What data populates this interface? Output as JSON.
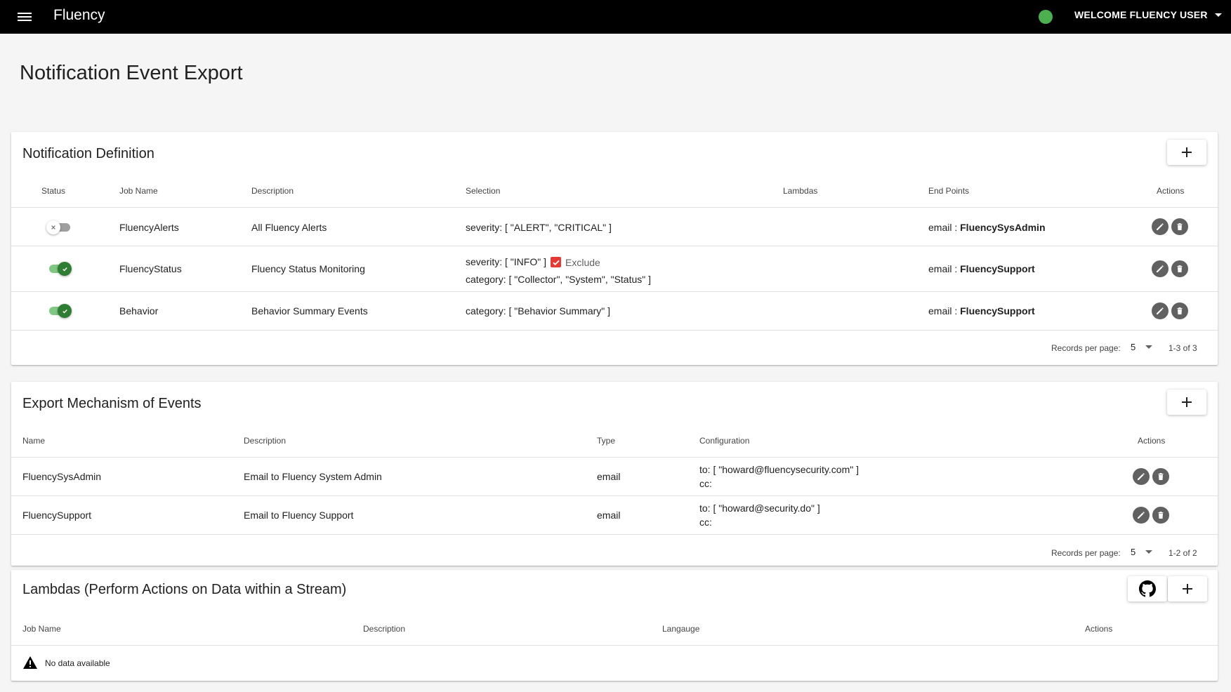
{
  "app": {
    "brand": "Fluency",
    "welcome": "WELCOME FLUENCY USER",
    "status_color": "#4caf50"
  },
  "page": {
    "title": "Notification Event Export"
  },
  "notification": {
    "title": "Notification Definition",
    "columns": [
      "Status",
      "Job Name",
      "Description",
      "Selection",
      "Lambdas",
      "End Points",
      "Actions"
    ],
    "rows": [
      {
        "enabled": false,
        "job_name": "FluencyAlerts",
        "description": "All Fluency Alerts",
        "selection_1": "severity: [ \"ALERT\", \"CRITICAL\" ]",
        "endpoint_prefix": "email : ",
        "endpoint_name": "FluencySysAdmin"
      },
      {
        "enabled": true,
        "job_name": "FluencyStatus",
        "description": "Fluency Status Monitoring",
        "selection_1": "severity: [ \"INFO\" ]",
        "exclude_label": "Exclude",
        "exclude_checked": true,
        "selection_2": "category: [ \"Collector\", \"System\", \"Status\" ]",
        "endpoint_prefix": "email : ",
        "endpoint_name": "FluencySupport"
      },
      {
        "enabled": true,
        "job_name": "Behavior",
        "description": "Behavior Summary Events",
        "selection_1": "category: [ \"Behavior Summary\" ]",
        "endpoint_prefix": "email : ",
        "endpoint_name": "FluencySupport"
      }
    ],
    "records_label": "Records per page:",
    "records_per_page": "5",
    "range": "1-3 of 3"
  },
  "export": {
    "title": "Export Mechanism of Events",
    "columns": [
      "Name",
      "Description",
      "Type",
      "Configuration",
      "Actions"
    ],
    "rows": [
      {
        "name": "FluencySysAdmin",
        "description": "Email to Fluency System Admin",
        "type": "email",
        "config_to": "to: [ \"howard@fluencysecurity.com\" ]",
        "config_cc": "cc:"
      },
      {
        "name": "FluencySupport",
        "description": "Email to Fluency Support",
        "type": "email",
        "config_to": "to: [ \"howard@security.do\" ]",
        "config_cc": "cc:"
      }
    ],
    "records_label": "Records per page:",
    "records_per_page": "5",
    "range": "1-2 of 2"
  },
  "lambdas": {
    "title": "Lambdas (Perform Actions on Data within a Stream)",
    "columns": [
      "Job Name",
      "Description",
      "Langauge",
      "Actions"
    ],
    "empty_text": "No data available"
  },
  "colors": {
    "toggle_on": "#2e7d32",
    "toggle_track_on": "#81c784",
    "exclude_checkbox": "#e53935",
    "topbar": "#000000"
  }
}
